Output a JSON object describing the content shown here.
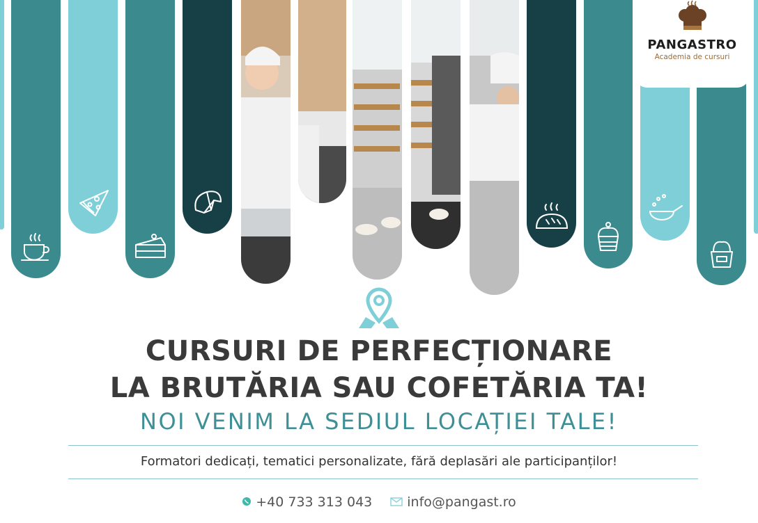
{
  "brand": {
    "name": "PANGASTRO",
    "tagline": "Academia de cursuri"
  },
  "headline": {
    "line1": "CURSURI DE PERFECȚIONARE",
    "line2": "LA BRUTĂRIA SAU COFETĂRIA TA!",
    "subtitle": "NOI VENIM LA SEDIUL LOCAȚIEI TALE!"
  },
  "tagline": "Formatori dedicați, tematici personalizate, fără deplasări ale participanților!",
  "contact": {
    "phone": "+40 733 313 043",
    "email": "info@pangast.ro"
  },
  "stripe_icons": [
    "coffee-cup-icon",
    "pizza-slice-icon",
    "cake-slice-icon",
    "croissant-icon",
    "bread-loaf-icon",
    "cupcake-icon",
    "frying-pan-icon",
    "ice-cream-cup-icon"
  ],
  "colors": {
    "teal": "#3a8a8e",
    "light_teal": "#7fcfd8",
    "dark_teal": "#163f46",
    "heading": "#3a3a3a",
    "subtitle": "#3f8f96",
    "logo_accent": "#9b6b38"
  }
}
